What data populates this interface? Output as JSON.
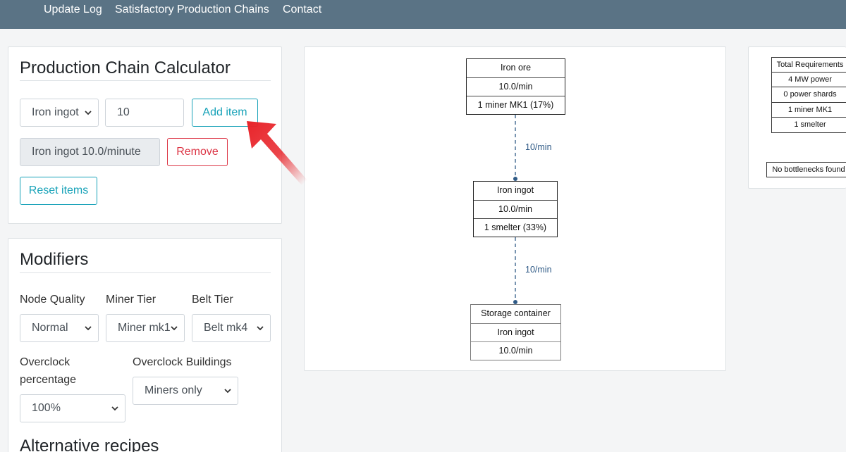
{
  "nav": {
    "links": [
      "Update Log",
      "Satisfactory Production Chains",
      "Contact"
    ]
  },
  "calculator": {
    "title": "Production Chain Calculator",
    "item_select": "Iron ingot",
    "quantity": "10",
    "add_label": "Add item",
    "added_item": "Iron ingot 10.0/minute",
    "remove_label": "Remove",
    "reset_label": "Reset items"
  },
  "modifiers": {
    "title": "Modifiers",
    "node_quality": {
      "label": "Node Quality",
      "value": "Normal"
    },
    "miner_tier": {
      "label": "Miner Tier",
      "value": "Miner mk1"
    },
    "belt_tier": {
      "label": "Belt Tier",
      "value": "Belt mk4"
    },
    "overclock_percentage": {
      "label_line1": "Overclock",
      "label_line2": "percentage",
      "value": "100%"
    },
    "overclock_buildings": {
      "label": "Overclock Buildings",
      "value": "Miners only"
    },
    "alt_title": "Alternative recipes"
  },
  "graph": {
    "nodes": [
      {
        "rows": [
          "Iron ore",
          "10.0/min",
          "1 miner MK1 (17%)"
        ]
      },
      {
        "rows": [
          "Iron ingot",
          "10.0/min",
          "1 smelter (33%)"
        ]
      },
      {
        "rows": [
          "Storage container",
          "Iron ingot",
          "10.0/min"
        ]
      }
    ],
    "edges": [
      {
        "label": "10/min"
      },
      {
        "label": "10/min"
      }
    ]
  },
  "requirements": {
    "rows": [
      "Total Requirements",
      "4 MW power",
      "0 power shards",
      "1 miner MK1",
      "1 smelter"
    ],
    "bottlenecks": "No bottlenecks found"
  },
  "colors": {
    "nav_bg": "#5a7385",
    "info": "#17a2b8",
    "danger": "#dc3545",
    "edge": "#2f5a86",
    "arrow": "#e8242a"
  },
  "icons": {
    "select_chevron": "chevron-down-icon",
    "annotation": "red-arrow-annotation"
  }
}
